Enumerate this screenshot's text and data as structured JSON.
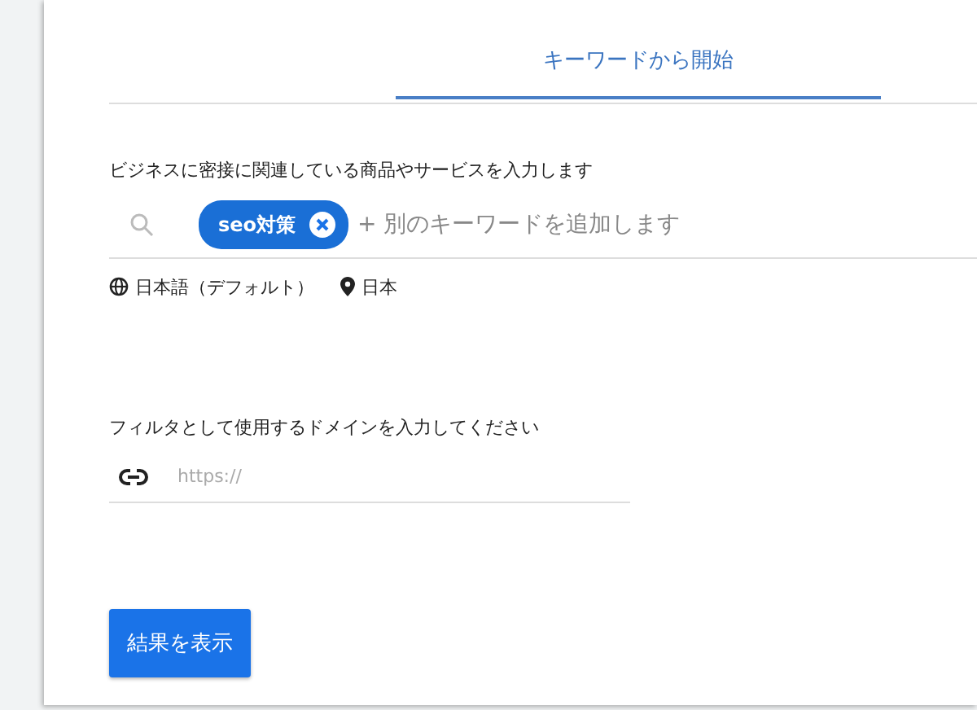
{
  "tabs": [
    {
      "label": "キーワードから開始",
      "selected": true
    }
  ],
  "keyword_section": {
    "label": "ビジネスに密接に関連している商品やサービスを入力します",
    "chips": [
      {
        "label": "seo対策"
      }
    ],
    "placeholder": "+ 別のキーワードを追加します"
  },
  "settings": {
    "language": "日本語（デフォルト）",
    "location": "日本"
  },
  "domain_section": {
    "label": "フィルタとして使用するドメインを入力してください",
    "placeholder": "https://"
  },
  "submit_button": "結果を表示"
}
